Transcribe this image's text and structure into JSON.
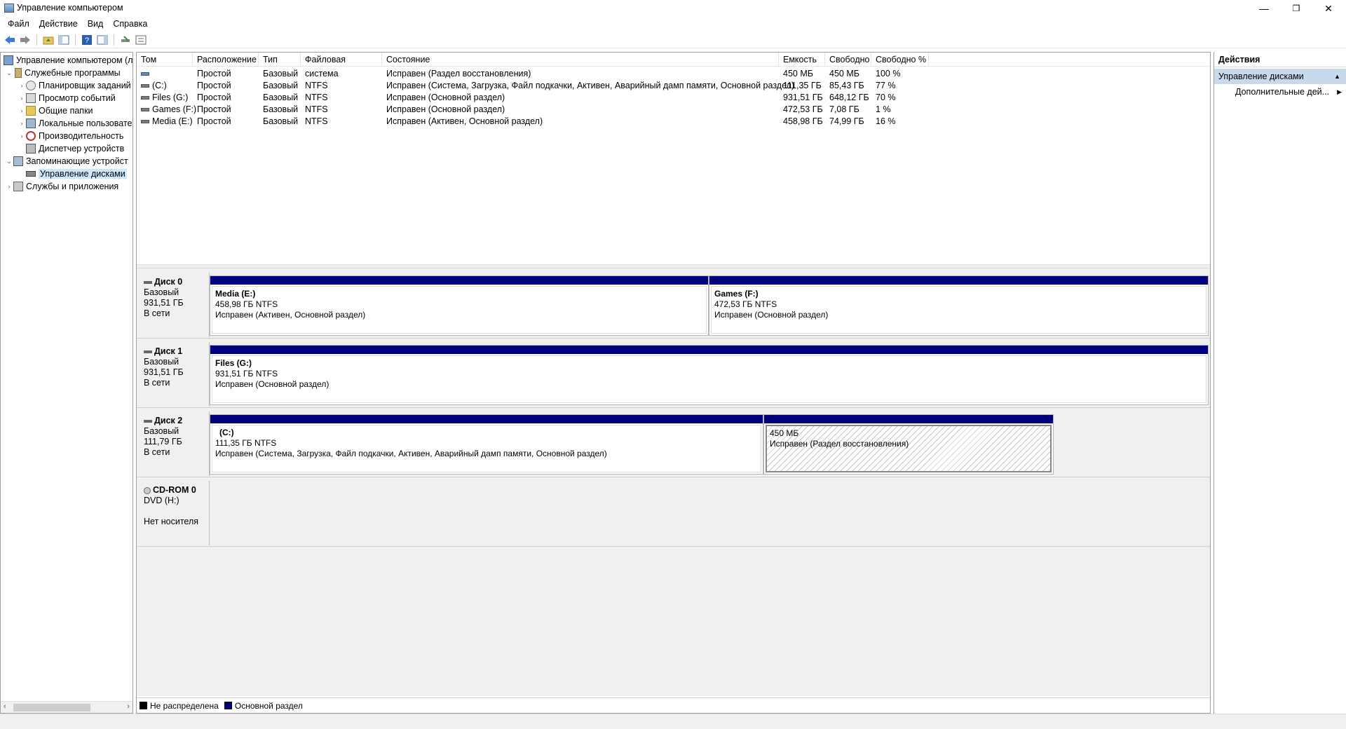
{
  "window": {
    "title": "Управление компьютером",
    "minimize": "—",
    "restore": "❐",
    "close": "✕"
  },
  "menu": [
    "Файл",
    "Действие",
    "Вид",
    "Справка"
  ],
  "tree": {
    "items": [
      {
        "label": "Управление компьютером (л",
        "level": 0,
        "arrow": "",
        "icon": "computer-management-icon"
      },
      {
        "label": "Служебные программы",
        "level": 1,
        "arrow": "⌄",
        "icon": "tools-icon"
      },
      {
        "label": "Планировщик заданий",
        "level": 2,
        "arrow": "›",
        "icon": "clock-icon"
      },
      {
        "label": "Просмотр событий",
        "level": 2,
        "arrow": "›",
        "icon": "event-viewer-icon"
      },
      {
        "label": "Общие папки",
        "level": 2,
        "arrow": "›",
        "icon": "shared-folder-icon"
      },
      {
        "label": "Локальные пользовате",
        "level": 2,
        "arrow": "›",
        "icon": "users-icon"
      },
      {
        "label": "Производительность",
        "level": 2,
        "arrow": "›",
        "icon": "performance-icon"
      },
      {
        "label": "Диспетчер устройств",
        "level": 2,
        "arrow": "",
        "icon": "device-manager-icon"
      },
      {
        "label": "Запоминающие устройст",
        "level": 1,
        "arrow": "⌄",
        "icon": "storage-icon"
      },
      {
        "label": "Управление дисками",
        "level": 2,
        "arrow": "",
        "icon": "disk-management-icon",
        "selected": true
      },
      {
        "label": "Службы и приложения",
        "level": 1,
        "arrow": "›",
        "icon": "services-icon"
      }
    ]
  },
  "table": {
    "columns": [
      "Том",
      "Расположение",
      "Тип",
      "Файловая система",
      "Состояние",
      "Емкость",
      "Свободно",
      "Свободно %"
    ],
    "rows": [
      [
        "",
        "Простой",
        "Базовый",
        "",
        "Исправен (Раздел восстановления)",
        "450 МБ",
        "450 МБ",
        "100 %"
      ],
      [
        "(C:)",
        "Простой",
        "Базовый",
        "NTFS",
        "Исправен (Система, Загрузка, Файл подкачки, Активен, Аварийный дамп памяти, Основной раздел)",
        "111,35 ГБ",
        "85,43 ГБ",
        "77 %"
      ],
      [
        "Files (G:)",
        "Простой",
        "Базовый",
        "NTFS",
        "Исправен (Основной раздел)",
        "931,51 ГБ",
        "648,12 ГБ",
        "70 %"
      ],
      [
        "Games (F:)",
        "Простой",
        "Базовый",
        "NTFS",
        "Исправен (Основной раздел)",
        "472,53 ГБ",
        "7,08 ГБ",
        "1 %"
      ],
      [
        "Media (E:)",
        "Простой",
        "Базовый",
        "NTFS",
        "Исправен (Активен, Основной раздел)",
        "458,98 ГБ",
        "74,99 ГБ",
        "16 %"
      ]
    ]
  },
  "disks": [
    {
      "name": "Диск 0",
      "type": "Базовый",
      "size": "931,51 ГБ",
      "status": "В сети",
      "partitions": [
        {
          "name": "Media  (E:)",
          "size": "458,98 ГБ NTFS",
          "status": "Исправен (Активен, Основной раздел)"
        },
        {
          "name": "Games  (F:)",
          "size": "472,53 ГБ NTFS",
          "status": "Исправен (Основной раздел)"
        }
      ]
    },
    {
      "name": "Диск 1",
      "type": "Базовый",
      "size": "931,51 ГБ",
      "status": "В сети",
      "partitions": [
        {
          "name": "Files  (G:)",
          "size": "931,51 ГБ NTFS",
          "status": "Исправен (Основной раздел)"
        }
      ]
    },
    {
      "name": "Диск 2",
      "type": "Базовый",
      "size": "111,79 ГБ",
      "status": "В сети",
      "partitions": [
        {
          "name": "(C:)",
          "size": "111,35 ГБ NTFS",
          "status": "Исправен (Система, Загрузка, Файл подкачки, Активен, Аварийный дамп памяти, Основной раздел)"
        },
        {
          "name": "",
          "size": "450 МБ",
          "status": "Исправен (Раздел восстановления)"
        }
      ]
    },
    {
      "name": "CD-ROM 0",
      "type": "DVD (H:)",
      "size": "",
      "status": "Нет носителя",
      "partitions": []
    }
  ],
  "legend": {
    "unallocated": "Не распределена",
    "primary": "Основной раздел"
  },
  "actions": {
    "header": "Действия",
    "section": "Управление дисками",
    "more": "Дополнительные дей..."
  },
  "colors": {
    "primary_partition": "#00007f",
    "selection": "#cce8ff",
    "actions_section": "#c9d9ec"
  }
}
